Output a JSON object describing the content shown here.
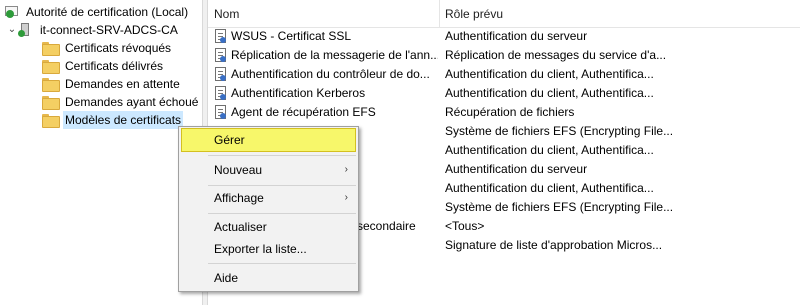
{
  "tree": {
    "root_label": "Autorité de certification (Local)",
    "server_label": "it-connect-SRV-ADCS-CA",
    "expander_glyph": "⌄",
    "folders": [
      {
        "label": "Certificats révoqués"
      },
      {
        "label": "Certificats délivrés"
      },
      {
        "label": "Demandes en attente"
      },
      {
        "label": "Demandes ayant échoué"
      },
      {
        "label": "Modèles de certificats"
      }
    ],
    "selected_folder": "Modèles de certificats"
  },
  "list": {
    "columns": [
      "Nom",
      "Rôle prévu"
    ],
    "rows": [
      {
        "name": "WSUS - Certificat SSL",
        "role": "Authentification du serveur"
      },
      {
        "name": "Réplication de la messagerie de l'ann...",
        "role": "Réplication de messages du service d'a..."
      },
      {
        "name": "Authentification du contrôleur de do...",
        "role": "Authentification du client, Authentifica..."
      },
      {
        "name": "Authentification Kerberos",
        "role": "Authentification du client, Authentifica..."
      },
      {
        "name": "Agent de récupération EFS",
        "role": "Récupération de fichiers"
      },
      {
        "name": "",
        "role": "Système de fichiers EFS (Encrypting File..."
      },
      {
        "name": "",
        "role": "Authentification du client, Authentifica..."
      },
      {
        "name": "",
        "role": "Authentification du serveur"
      },
      {
        "name": "",
        "role": "Authentification du client, Authentifica..."
      },
      {
        "name": "",
        "role": "Système de fichiers EFS (Encrypting File..."
      },
      {
        "name": "secondaire",
        "role": "<Tous>"
      },
      {
        "name": "",
        "role": "Signature de liste d'approbation Micros..."
      }
    ]
  },
  "context_menu": {
    "items": [
      {
        "label": "Gérer",
        "highlighted": true
      },
      {
        "label": "Nouveau",
        "submenu": true
      },
      {
        "label": "Affichage",
        "submenu": true
      },
      {
        "label": "Actualiser"
      },
      {
        "label": "Exporter la liste..."
      },
      {
        "label": "Aide"
      }
    ],
    "submenu_glyph": "›"
  },
  "colors": {
    "highlight": "#f7f76a",
    "selection": "#cce8ff",
    "folder": "#f4cf63"
  }
}
